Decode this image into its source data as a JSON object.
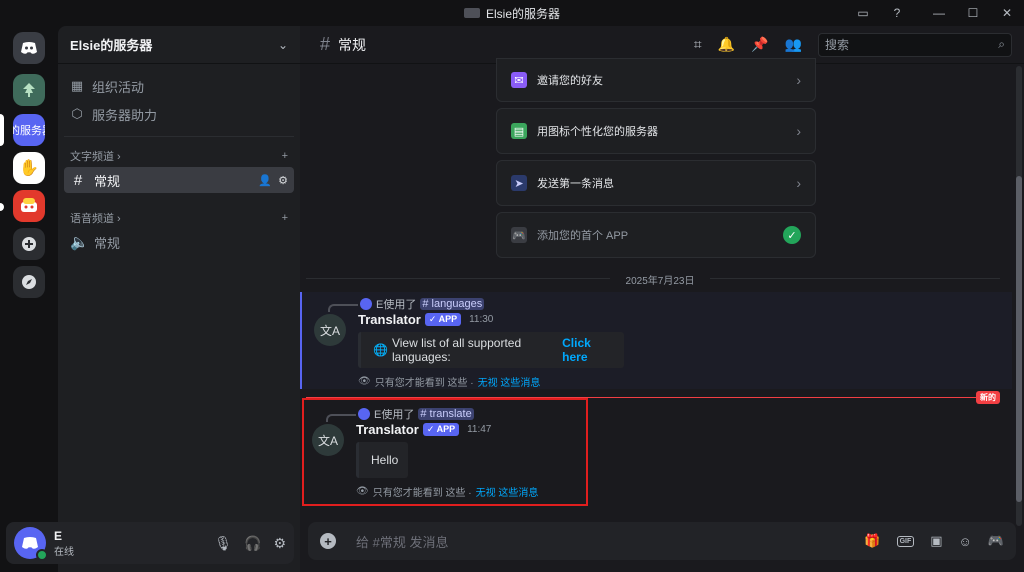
{
  "window": {
    "title": "Elsie的服务器"
  },
  "rail": {
    "server_label": "的服务器",
    "colors": {
      "accent": "#5865f2",
      "active_server": "#5865f2"
    }
  },
  "sidebar": {
    "server_name": "Elsie的服务器",
    "links": [
      {
        "label": "组织活动",
        "icon": "calendar-icon"
      },
      {
        "label": "服务器助力",
        "icon": "boost-icon"
      }
    ],
    "text_category": "文字频道",
    "voice_category": "语音频道",
    "text_channel": "常规",
    "voice_channel": "常规"
  },
  "user": {
    "avatar_letter": "E",
    "name": "E",
    "status": "在线"
  },
  "header": {
    "channel": "常规",
    "search_placeholder": "搜索"
  },
  "setup_cards": [
    {
      "label": "邀请您的好友",
      "icon": "invite-icon",
      "done": false
    },
    {
      "label": "用图标个性化您的服务器",
      "icon": "palette-icon",
      "done": false
    },
    {
      "label": "发送第一条消息",
      "icon": "send-icon",
      "done": false
    },
    {
      "label": "添加您的首个 APP",
      "icon": "gamepad-icon",
      "done": true
    }
  ],
  "date_divider": "2025年7月23日",
  "messages": [
    {
      "reply_user": "E使用了",
      "reply_command": "# languages",
      "author": "Translator",
      "badge": "✓ APP",
      "time": "11:30",
      "embed_text": "View list of all supported languages:",
      "embed_link": "Click here",
      "eph_text": "只有您才能看到 这些 ·",
      "eph_dismiss": "无视 这些消息"
    },
    {
      "reply_user": "E使用了",
      "reply_command": "# translate",
      "author": "Translator",
      "badge": "✓ APP",
      "time": "11:47",
      "embed_text": "Hello",
      "eph_text": "只有您才能看到 这些 ·",
      "eph_dismiss": "无视 这些消息"
    }
  ],
  "new_badge": "新的",
  "composer": {
    "placeholder": "给 #常规 发消息"
  }
}
